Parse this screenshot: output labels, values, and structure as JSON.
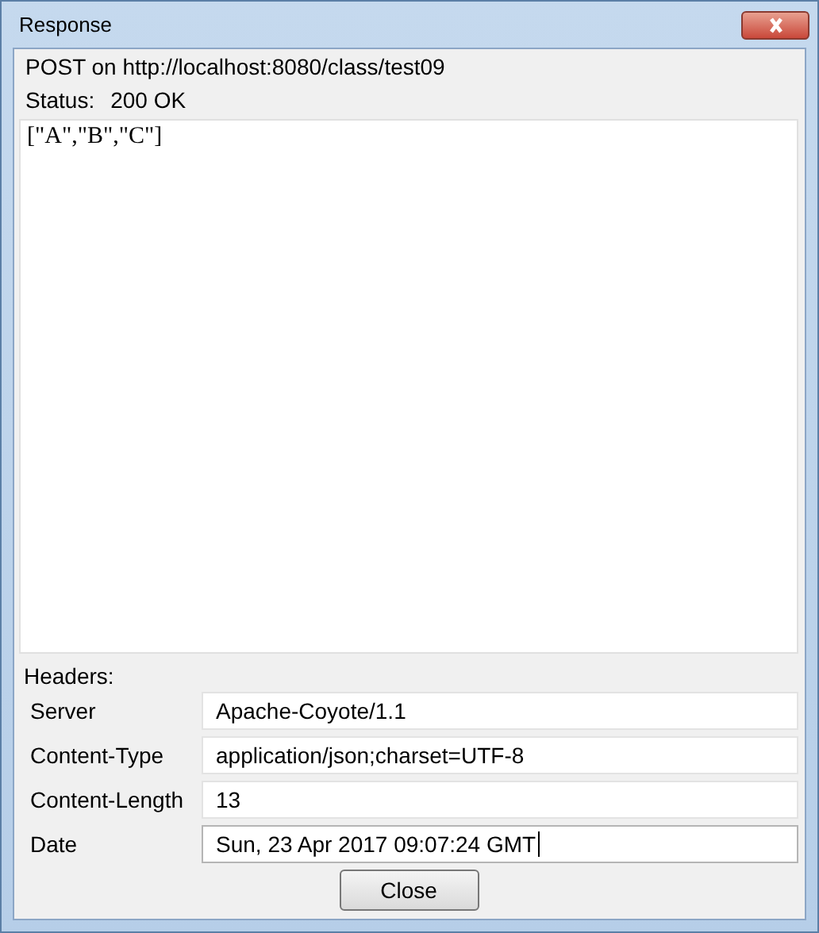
{
  "window": {
    "title": "Response"
  },
  "request_line": "POST on http://localhost:8080/class/test09",
  "status": {
    "label": "Status:",
    "value": "200 OK"
  },
  "body": "[\"A\",\"B\",\"C\"]",
  "headers": {
    "label": "Headers:",
    "rows": [
      {
        "name": "Server",
        "value": "Apache-Coyote/1.1",
        "focused": false
      },
      {
        "name": "Content-Type",
        "value": "application/json;charset=UTF-8",
        "focused": false
      },
      {
        "name": "Content-Length",
        "value": "13",
        "focused": false
      },
      {
        "name": "Date",
        "value": "Sun, 23 Apr 2017 09:07:24 GMT",
        "focused": true
      }
    ]
  },
  "buttons": [
    "Close"
  ]
}
